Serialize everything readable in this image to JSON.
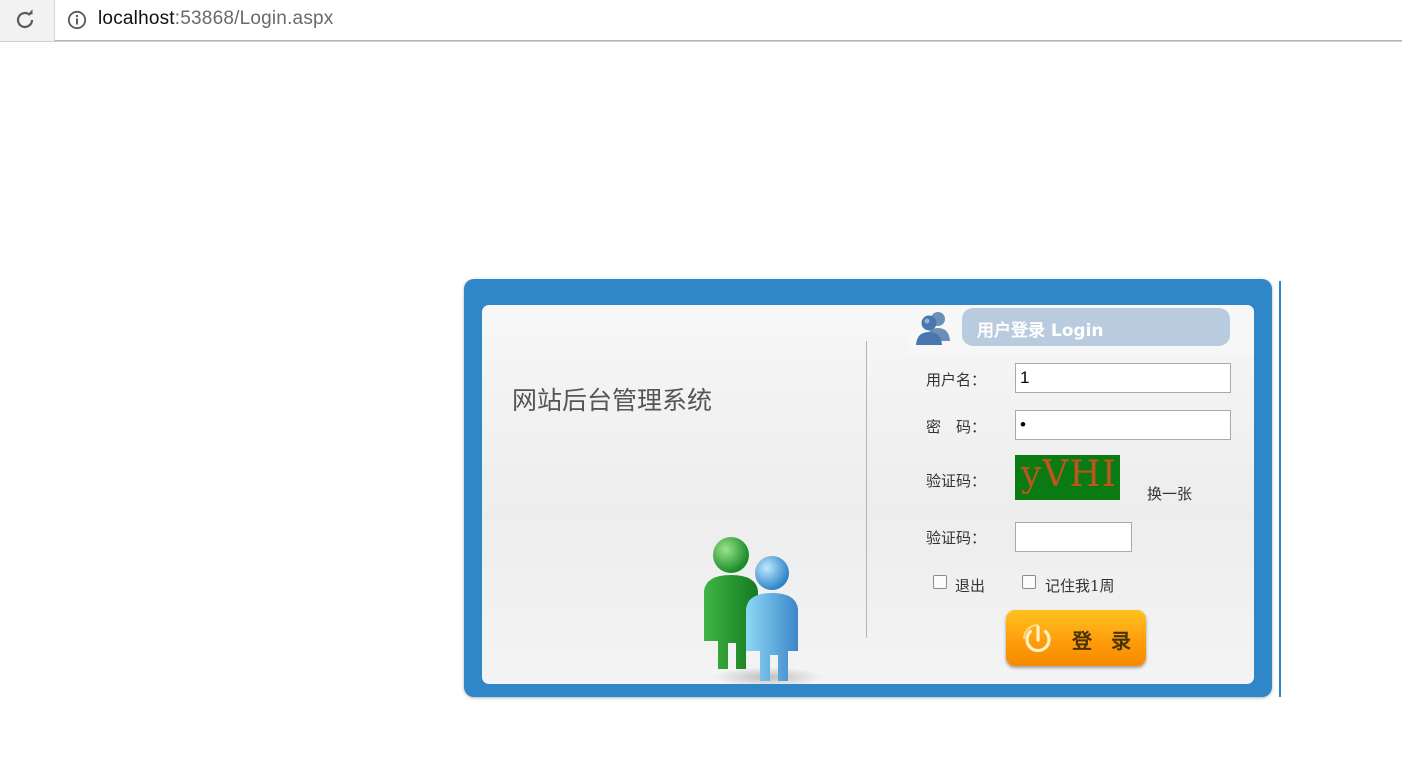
{
  "browser": {
    "url_host": "localhost",
    "url_rest": ":53868/Login.aspx",
    "reload_icon": "reload-icon",
    "info_icon": "info-icon"
  },
  "login": {
    "system_title": "网站后台管理系统",
    "header_title": "用户登录 Login",
    "username_label": "用户名：",
    "username_value": "1",
    "password_label": "密　码：",
    "password_value": "1",
    "captcha_label": "验证码：",
    "captcha_text": "yVHI",
    "refresh_link": "换一张",
    "captcha_input_label": "验证码：",
    "captcha_input_value": "",
    "exit_checkbox_label": "退出",
    "remember_checkbox_label": "记住我1周",
    "submit_label": "登 录"
  },
  "colors": {
    "panel_blue": "#2f86c9",
    "captcha_bg": "#0a7a12",
    "captcha_fg": "#c0541e",
    "button_orange": "#ff9d0c"
  }
}
